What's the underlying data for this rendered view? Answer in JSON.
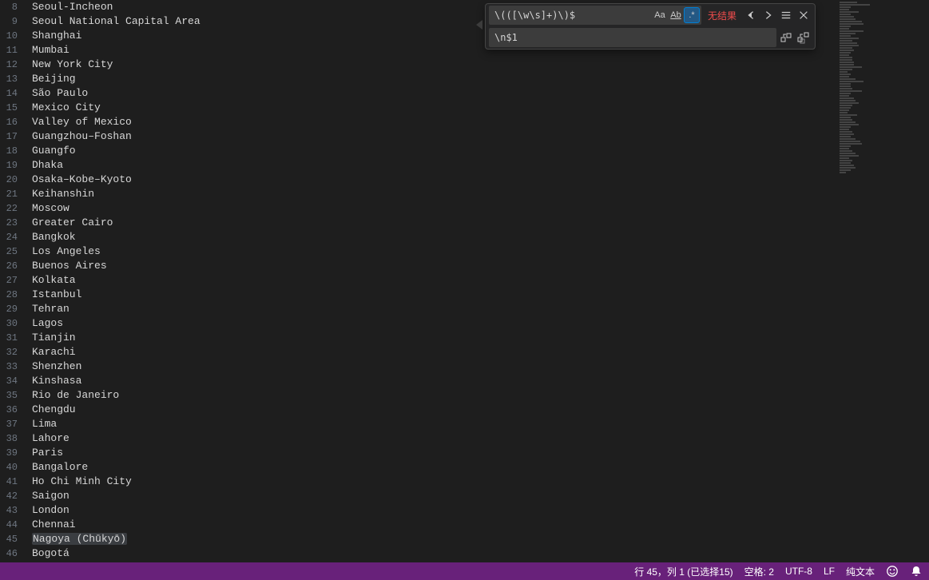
{
  "editor": {
    "lines": [
      {
        "n": 8,
        "text": "Seoul-Incheon"
      },
      {
        "n": 9,
        "text": "Seoul National Capital Area"
      },
      {
        "n": 10,
        "text": "Shanghai"
      },
      {
        "n": 11,
        "text": "Mumbai"
      },
      {
        "n": 12,
        "text": "New York City"
      },
      {
        "n": 13,
        "text": "Beijing"
      },
      {
        "n": 14,
        "text": "São Paulo"
      },
      {
        "n": 15,
        "text": "Mexico City"
      },
      {
        "n": 16,
        "text": "Valley of Mexico"
      },
      {
        "n": 17,
        "text": "Guangzhou–Foshan"
      },
      {
        "n": 18,
        "text": "Guangfo"
      },
      {
        "n": 19,
        "text": "Dhaka"
      },
      {
        "n": 20,
        "text": "Osaka–Kobe–Kyoto"
      },
      {
        "n": 21,
        "text": "Keihanshin"
      },
      {
        "n": 22,
        "text": "Moscow"
      },
      {
        "n": 23,
        "text": "Greater Cairo"
      },
      {
        "n": 24,
        "text": "Bangkok"
      },
      {
        "n": 25,
        "text": "Los Angeles"
      },
      {
        "n": 26,
        "text": "Buenos Aires"
      },
      {
        "n": 27,
        "text": "Kolkata"
      },
      {
        "n": 28,
        "text": "Istanbul"
      },
      {
        "n": 29,
        "text": "Tehran"
      },
      {
        "n": 30,
        "text": "Lagos"
      },
      {
        "n": 31,
        "text": "Tianjin"
      },
      {
        "n": 32,
        "text": "Karachi"
      },
      {
        "n": 33,
        "text": "Shenzhen"
      },
      {
        "n": 34,
        "text": "Kinshasa"
      },
      {
        "n": 35,
        "text": "Rio de Janeiro"
      },
      {
        "n": 36,
        "text": "Chengdu"
      },
      {
        "n": 37,
        "text": "Lima"
      },
      {
        "n": 38,
        "text": "Lahore"
      },
      {
        "n": 39,
        "text": "Paris"
      },
      {
        "n": 40,
        "text": "Bangalore"
      },
      {
        "n": 41,
        "text": "Ho Chi Minh City"
      },
      {
        "n": 42,
        "text": "Saigon"
      },
      {
        "n": 43,
        "text": "London"
      },
      {
        "n": 44,
        "text": "Chennai"
      },
      {
        "n": 45,
        "text": "Nagoya (Chūkyō)",
        "selected": true
      },
      {
        "n": 46,
        "text": "Bogotá"
      }
    ]
  },
  "find": {
    "search_value": "\\(([\\w\\s]+)\\)$",
    "replace_value": "\\n$1",
    "result_text": "无结果",
    "case_label": "Aa",
    "word_label": "Ab",
    "regex_label": ".*",
    "regex_active": true
  },
  "status": {
    "cursor": "行 45，列 1 (已选择15)",
    "indent": "空格: 2",
    "encoding": "UTF-8",
    "eol": "LF",
    "language": "纯文本"
  },
  "minimap": {
    "widths": [
      22,
      38,
      14,
      12,
      24,
      14,
      18,
      20,
      28,
      30,
      14,
      12,
      30,
      20,
      14,
      24,
      16,
      22,
      24,
      16,
      18,
      14,
      12,
      16,
      16,
      18,
      18,
      28,
      16,
      10,
      14,
      12,
      20,
      30,
      14,
      14,
      16,
      28,
      14,
      12,
      18,
      20,
      24,
      16,
      14,
      12,
      10,
      22,
      14,
      16,
      20,
      24,
      14,
      12,
      16,
      18,
      14,
      20,
      26,
      28,
      14,
      12,
      16,
      20,
      24,
      12,
      16,
      14,
      18,
      20,
      14,
      8
    ]
  }
}
